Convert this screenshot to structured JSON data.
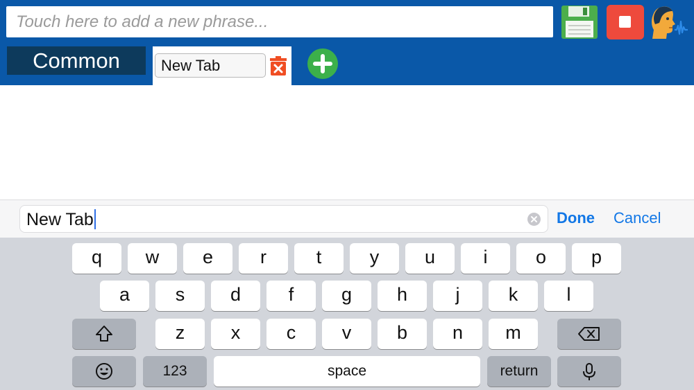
{
  "header": {
    "phrase_placeholder": "Touch here to add a new phrase...",
    "icons": {
      "save": "floppy-disk-icon",
      "stop": "stop-icon",
      "speak": "speaking-head-icon"
    },
    "colors": {
      "header_bg": "#0a58a8",
      "stop_button": "#ee4a3c",
      "add_tab": "#3cb04a",
      "delete_tab": "#f04e23"
    }
  },
  "tabs": {
    "common_label": "Common",
    "active_tab_value": "New Tab",
    "delete_icon": "trash-x-icon",
    "add_icon": "plus-circle-icon"
  },
  "edit_bar": {
    "value": "New Tab",
    "done_label": "Done",
    "cancel_label": "Cancel"
  },
  "keyboard": {
    "row1": [
      "q",
      "w",
      "e",
      "r",
      "t",
      "y",
      "u",
      "i",
      "o",
      "p"
    ],
    "row2": [
      "a",
      "s",
      "d",
      "f",
      "g",
      "h",
      "j",
      "k",
      "l"
    ],
    "row3": [
      "z",
      "x",
      "c",
      "v",
      "b",
      "n",
      "m"
    ],
    "numbers_label": "123",
    "space_label": "space",
    "return_label": "return"
  }
}
